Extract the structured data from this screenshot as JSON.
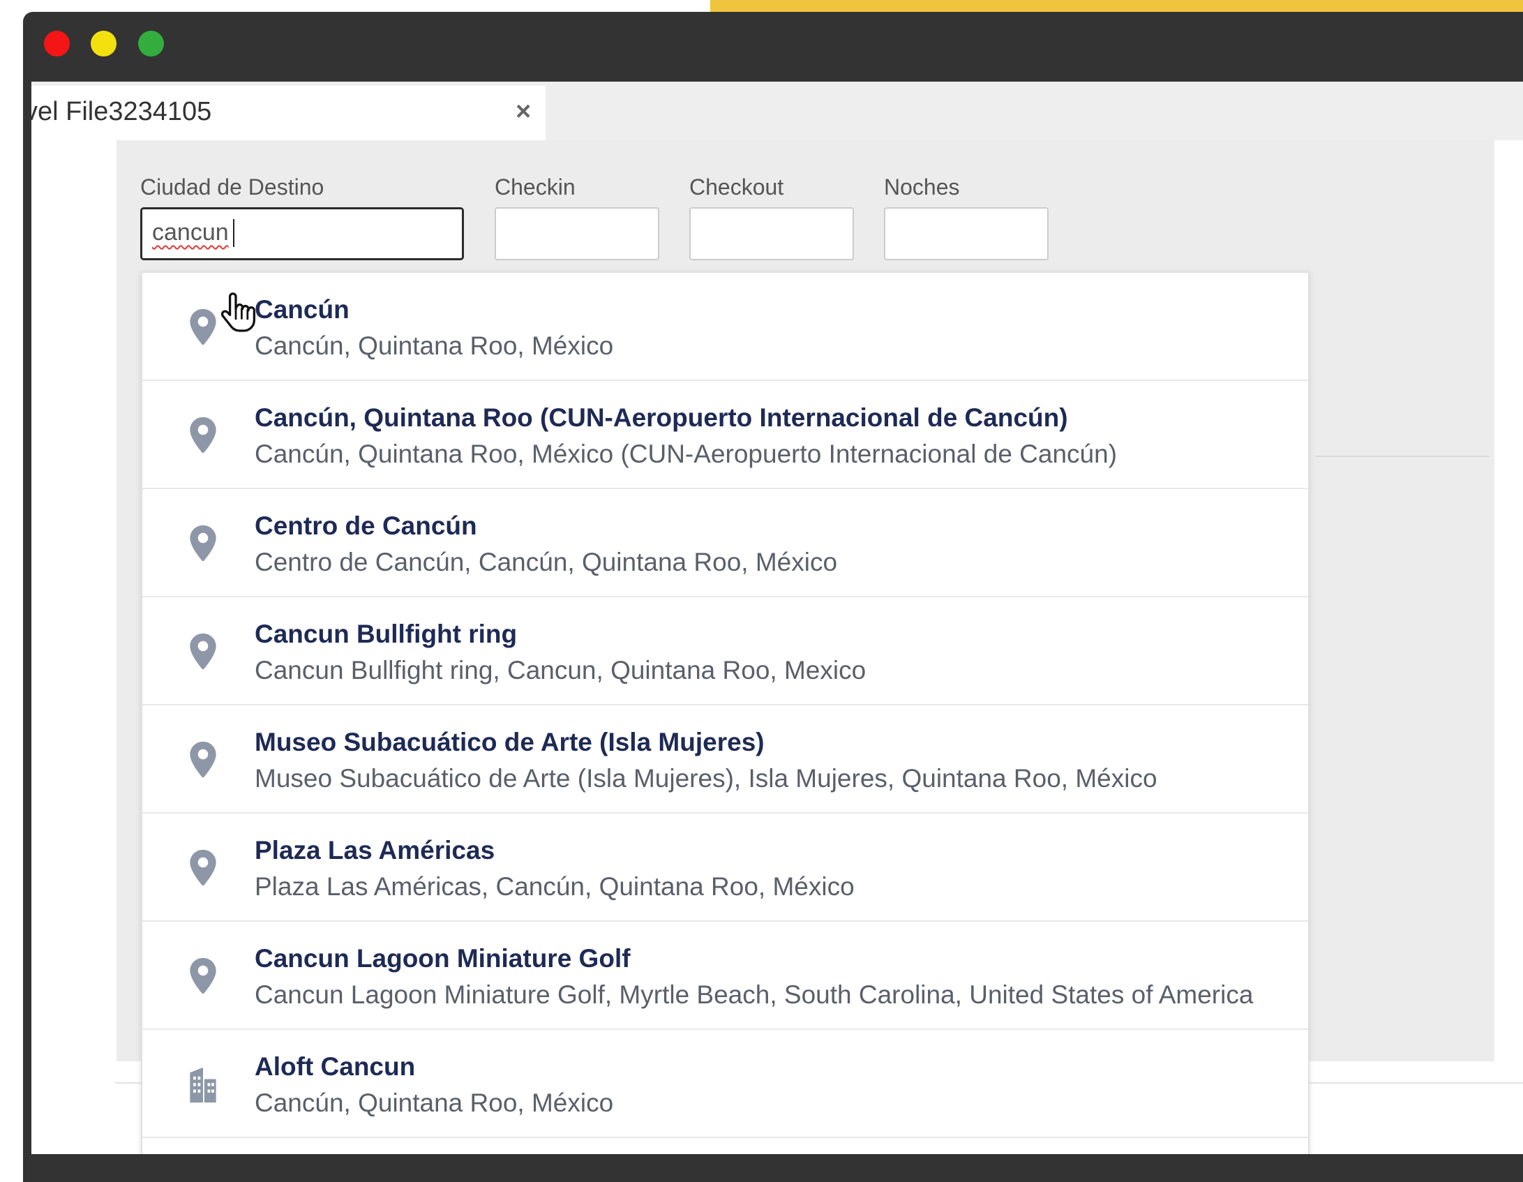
{
  "tab": {
    "title": "vel File3234105",
    "close_label": "×"
  },
  "form": {
    "destination": {
      "label": "Ciudad de Destino",
      "value": "cancun"
    },
    "checkin": {
      "label": "Checkin",
      "value": ""
    },
    "checkout": {
      "label": "Checkout",
      "value": ""
    },
    "nights": {
      "label": "Noches",
      "value": ""
    }
  },
  "suggestions": [
    {
      "title": "Cancún",
      "subtitle": "Cancún, Quintana Roo, México",
      "icon": "map-pin-icon"
    },
    {
      "title": "Cancún, Quintana Roo (CUN-Aeropuerto Internacional de Cancún)",
      "subtitle": "Cancún, Quintana Roo, México (CUN-Aeropuerto Internacional de Cancún)",
      "icon": "map-pin-icon"
    },
    {
      "title": "Centro de Cancún",
      "subtitle": "Centro de Cancún, Cancún, Quintana Roo, México",
      "icon": "map-pin-icon"
    },
    {
      "title": "Cancun Bullfight ring",
      "subtitle": "Cancun Bullfight ring, Cancun, Quintana Roo, Mexico",
      "icon": "map-pin-icon"
    },
    {
      "title": "Museo Subacuático de Arte (Isla Mujeres)",
      "subtitle": "Museo Subacuático de Arte (Isla Mujeres), Isla Mujeres, Quintana Roo, México",
      "icon": "map-pin-icon"
    },
    {
      "title": "Plaza Las Américas",
      "subtitle": "Plaza Las Américas, Cancún, Quintana Roo, México",
      "icon": "map-pin-icon"
    },
    {
      "title": "Cancun Lagoon Miniature Golf",
      "subtitle": "Cancun Lagoon Miniature Golf, Myrtle Beach, South Carolina, United States of America",
      "icon": "map-pin-icon"
    },
    {
      "title": "Aloft Cancun",
      "subtitle": "Cancún, Quintana Roo, México",
      "icon": "building-icon"
    }
  ],
  "colors": {
    "title_text": "#1e2a55",
    "subtitle_text": "#5a5f6a",
    "icon": "#8e97a8",
    "window_chrome": "#333333",
    "accent_yellow": "#f0c43c"
  }
}
